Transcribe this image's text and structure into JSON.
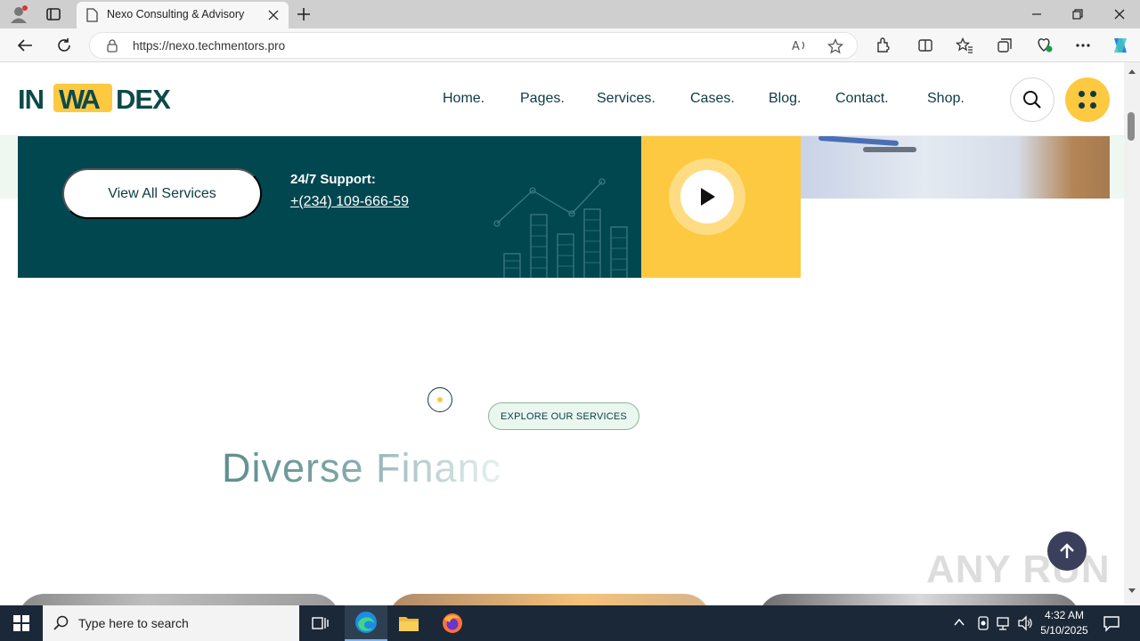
{
  "browser": {
    "tab_title": "Nexo Consulting & Advisory",
    "url": "https://nexo.techmentors.pro"
  },
  "site": {
    "logo_left": "IN",
    "logo_mid": "WA",
    "logo_right": "DEX",
    "nav": [
      "Home.",
      "Pages.",
      "Services.",
      "Cases.",
      "Blog.",
      "Contact.",
      "Shop."
    ]
  },
  "hero": {
    "view_all_label": "View All Services",
    "support_label": "24/7 Support:",
    "support_phone": "+(234) 109-666-59"
  },
  "services": {
    "eyebrow": "EXPLORE OUR SERVICES",
    "heading": "Diverse Financ"
  },
  "watermark": "ANY RUN",
  "taskbar": {
    "search_placeholder": "Type here to search",
    "time": "4:32 AM",
    "date": "5/10/2025"
  },
  "colors": {
    "teal": "#004750",
    "yellow": "#fdc941",
    "navy_text": "#0d3b44",
    "mint": "#eef8f1"
  }
}
